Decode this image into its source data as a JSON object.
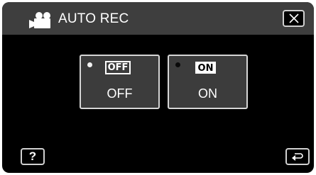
{
  "header": {
    "title": "AUTO REC",
    "icon": "movie-camera-icon",
    "close_icon": "close-icon"
  },
  "options": [
    {
      "badge": "OFF",
      "label": "OFF",
      "selected": true
    },
    {
      "badge": "ON",
      "label": "ON",
      "selected": false
    }
  ],
  "footer": {
    "help_label": "?",
    "back_icon": "return-arrow-icon"
  }
}
